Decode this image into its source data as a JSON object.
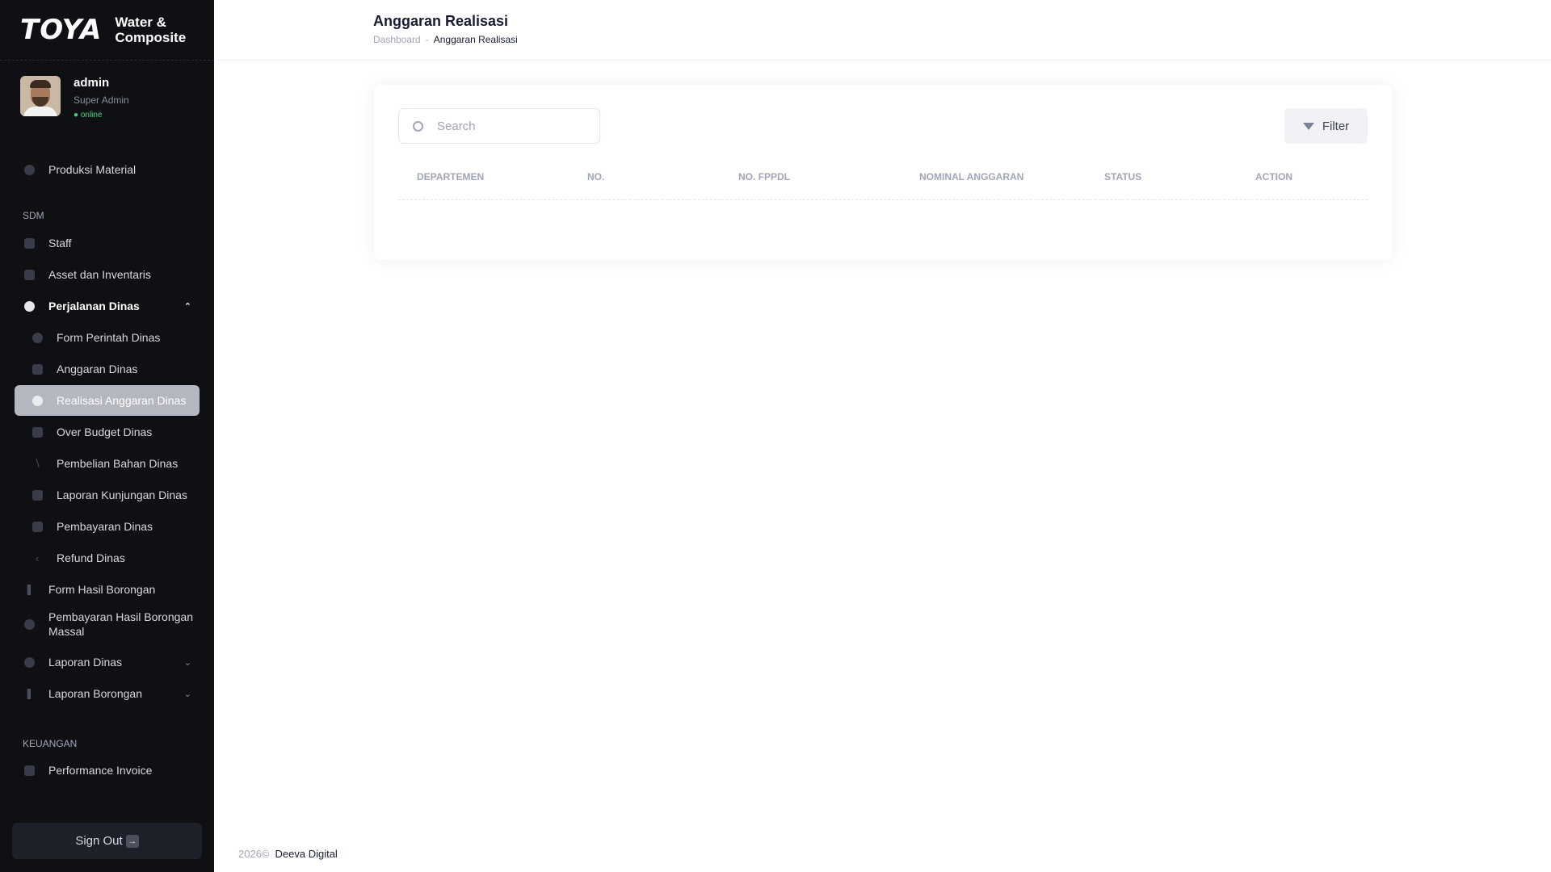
{
  "brand": {
    "logo": "TOYA",
    "subtitle_line1": "Water &",
    "subtitle_line2": "Composite"
  },
  "user": {
    "name": "admin",
    "role": "Super Admin",
    "status": "● online"
  },
  "sidebar": {
    "items": [
      {
        "label": "Produksi Material"
      },
      {
        "section": "SDM"
      },
      {
        "label": "Staff"
      },
      {
        "label": "Asset dan Inventaris"
      },
      {
        "label": "Perjalanan Dinas"
      },
      {
        "label": "Form Perintah Dinas"
      },
      {
        "label": "Anggaran Dinas"
      },
      {
        "label": "Realisasi Anggaran Dinas"
      },
      {
        "label": "Over Budget Dinas"
      },
      {
        "label": "Pembelian Bahan Dinas"
      },
      {
        "label": "Laporan Kunjungan Dinas"
      },
      {
        "label": "Pembayaran Dinas"
      },
      {
        "label": "Refund Dinas"
      },
      {
        "label": "Form Hasil Borongan"
      },
      {
        "label": "Pembayaran Hasil Borongan Massal"
      },
      {
        "label": "Laporan Dinas"
      },
      {
        "label": "Laporan Borongan"
      },
      {
        "section": "KEUANGAN"
      },
      {
        "label": "Performance Invoice"
      }
    ],
    "signout_label": "Sign Out"
  },
  "header": {
    "title": "Anggaran Realisasi",
    "breadcrumb": {
      "home": "Dashboard",
      "separator": "-",
      "current": "Anggaran Realisasi"
    }
  },
  "search": {
    "placeholder": "Search",
    "value": ""
  },
  "toolbar": {
    "filter_label": "Filter"
  },
  "table": {
    "columns": [
      "DEPARTEMEN",
      "NO.",
      "NO. FPPDL",
      "NOMINAL ANGGARAN",
      "STATUS",
      "ACTION"
    ],
    "rows": []
  },
  "footer": {
    "year": "2026©",
    "company": "Deeva Digital"
  },
  "colors": {
    "sidebar_bg": "#0f1014",
    "active_item_bg": "#b5b7c0",
    "online": "#50cd89"
  },
  "icons": [
    "search-icon",
    "filter-icon",
    "chevron-up-icon",
    "chevron-down-icon",
    "sign-out-icon"
  ]
}
